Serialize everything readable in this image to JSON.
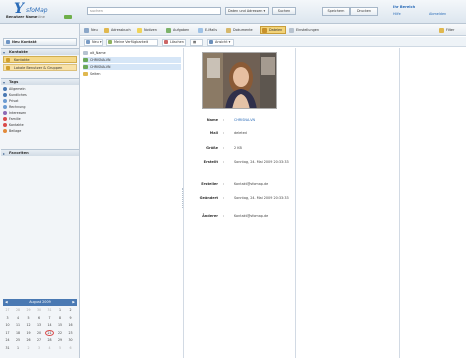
{
  "header": {
    "logo_mark": "Y",
    "logo_text": "sfoMap",
    "user_name": "Benutzer Name",
    "user_state": "online",
    "search_placeholder": "suchen",
    "filter_label": "Daten und Adressen ▾",
    "search_button": "Suchen",
    "save_tabs": [
      "Speichern",
      "Drucken"
    ],
    "right_title": "Ihr Bereich",
    "right_links": [
      "Hilfe",
      "Abmelden"
    ]
  },
  "toolbar": {
    "items": [
      "Neu",
      "Adressbuch",
      "Notizen",
      "Aufgaben",
      "E-Mails",
      "Dokumente",
      "Dateien",
      "Einstellungen"
    ],
    "end_item": "Filter"
  },
  "toolbar2": {
    "items": [
      "Neu ▾",
      "Meine Verfügbarkeit",
      "Löschen",
      "Ansicht ▾"
    ]
  },
  "sidebar": {
    "top_button": "Neu Kontakt",
    "groups_title": "Kontakte",
    "groups": [
      "Kontakte",
      "Lokale Benutzer & Gruppen"
    ],
    "tags_title": "Tags",
    "tags": [
      "Allgemein",
      "Kundliches",
      "Privat",
      "Rechnung",
      "Interessen",
      "Familie",
      "Kontakte",
      "Beilage"
    ],
    "favs_title": "Favoriten",
    "calendar_title": "August 2009",
    "calendar_days": [
      "27",
      "28",
      "29",
      "30",
      "31",
      "1",
      "2",
      "3",
      "4",
      "5",
      "6",
      "7",
      "8",
      "9",
      "10",
      "11",
      "12",
      "13",
      "14",
      "15",
      "16",
      "17",
      "18",
      "19",
      "20",
      "21",
      "22",
      "23",
      "24",
      "25",
      "26",
      "27",
      "28",
      "29",
      "30",
      "31",
      "1",
      "2",
      "3",
      "4",
      "5",
      "6"
    ]
  },
  "list": {
    "rows": [
      "alt_Name",
      "CHRISNA-VN",
      "CHRISNA-VN",
      "Seiten"
    ]
  },
  "detail": {
    "fields": [
      {
        "label": "Name",
        "value": "CHRISNA-VN",
        "link": true
      },
      {
        "label": "Mail",
        "value": "deleted",
        "link": false
      },
      {
        "label": "Größe",
        "value": "2 KB",
        "link": false
      },
      {
        "label": "Erstellt",
        "value": "Sonntag, 24. Mai 2009 20:33:33",
        "link": false
      },
      {
        "label": "Ersteller",
        "value": "Kontakt@sfomap.de",
        "link": false
      },
      {
        "label": "Geändert",
        "value": "Sonntag, 24. Mai 2009 20:33:33",
        "link": false
      },
      {
        "label": "Änderer",
        "value": "Kontakt@sfomap.de",
        "link": false
      }
    ]
  },
  "colors": {
    "accent": "#2b6cb8",
    "header_bg": "#dde6ef",
    "selection": "#d6e6f7",
    "calendar_header": "#4a79b3"
  }
}
